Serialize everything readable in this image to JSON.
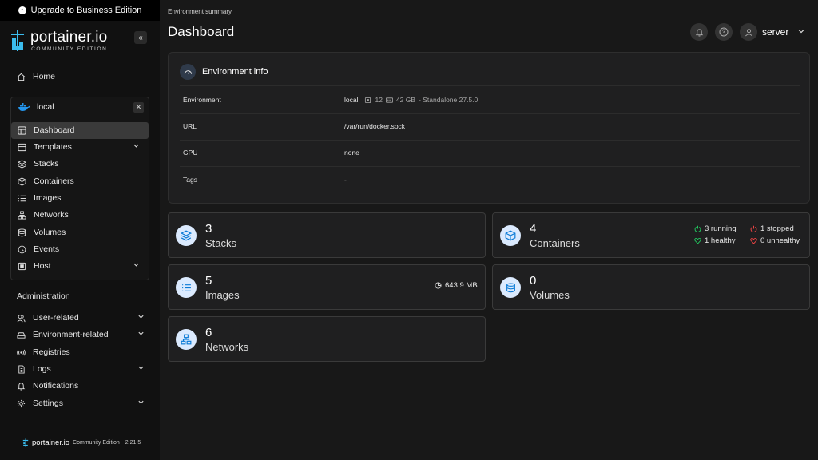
{
  "banner": {
    "label": "Upgrade to Business Edition"
  },
  "logo": {
    "brand": "portainer.io",
    "edition": "COMMUNITY EDITION"
  },
  "sidebar": {
    "home": "Home",
    "environment": {
      "name": "local"
    },
    "env_items": [
      {
        "label": "Dashboard",
        "icon": "dashboard-icon",
        "active": true
      },
      {
        "label": "Templates",
        "icon": "templates-icon",
        "has_chevron": true
      },
      {
        "label": "Stacks",
        "icon": "stacks-icon"
      },
      {
        "label": "Containers",
        "icon": "containers-icon"
      },
      {
        "label": "Images",
        "icon": "images-icon"
      },
      {
        "label": "Networks",
        "icon": "networks-icon"
      },
      {
        "label": "Volumes",
        "icon": "volumes-icon"
      },
      {
        "label": "Events",
        "icon": "events-icon"
      },
      {
        "label": "Host",
        "icon": "host-icon",
        "has_chevron": true
      }
    ],
    "admin_title": "Administration",
    "admin_items": [
      {
        "label": "User-related",
        "icon": "users-icon",
        "has_chevron": true
      },
      {
        "label": "Environment-related",
        "icon": "environment-icon",
        "has_chevron": true
      },
      {
        "label": "Registries",
        "icon": "registries-icon"
      },
      {
        "label": "Logs",
        "icon": "logs-icon",
        "has_chevron": true
      },
      {
        "label": "Notifications",
        "icon": "bell-icon"
      },
      {
        "label": "Settings",
        "icon": "gear-icon",
        "has_chevron": true
      }
    ]
  },
  "footer": {
    "brand": "portainer.io",
    "edition": "Community Edition",
    "version": "2.21.5"
  },
  "header": {
    "breadcrumb": "Environment summary",
    "title": "Dashboard",
    "user": "server"
  },
  "env_info": {
    "title": "Environment info",
    "rows": [
      {
        "label": "Environment",
        "value": "local",
        "cpu": "12",
        "memory": "42 GB",
        "detail": "- Standalone 27.5.0"
      },
      {
        "label": "URL",
        "value": "/var/run/docker.sock"
      },
      {
        "label": "GPU",
        "value": "none"
      },
      {
        "label": "Tags",
        "value": "-"
      }
    ]
  },
  "cards": {
    "stacks": {
      "count": "3",
      "label": "Stacks"
    },
    "containers": {
      "count": "4",
      "label": "Containers",
      "running": "3 running",
      "stopped": "1 stopped",
      "healthy": "1 healthy",
      "unhealthy": "0 unhealthy"
    },
    "images": {
      "count": "5",
      "label": "Images",
      "size": "643.9 MB"
    },
    "volumes": {
      "count": "0",
      "label": "Volumes"
    },
    "networks": {
      "count": "6",
      "label": "Networks"
    }
  },
  "colors": {
    "accent": "#0b7bd6",
    "running": "#22c55e",
    "stopped": "#ef4444",
    "card_icon_bg": "#dbeafe"
  }
}
